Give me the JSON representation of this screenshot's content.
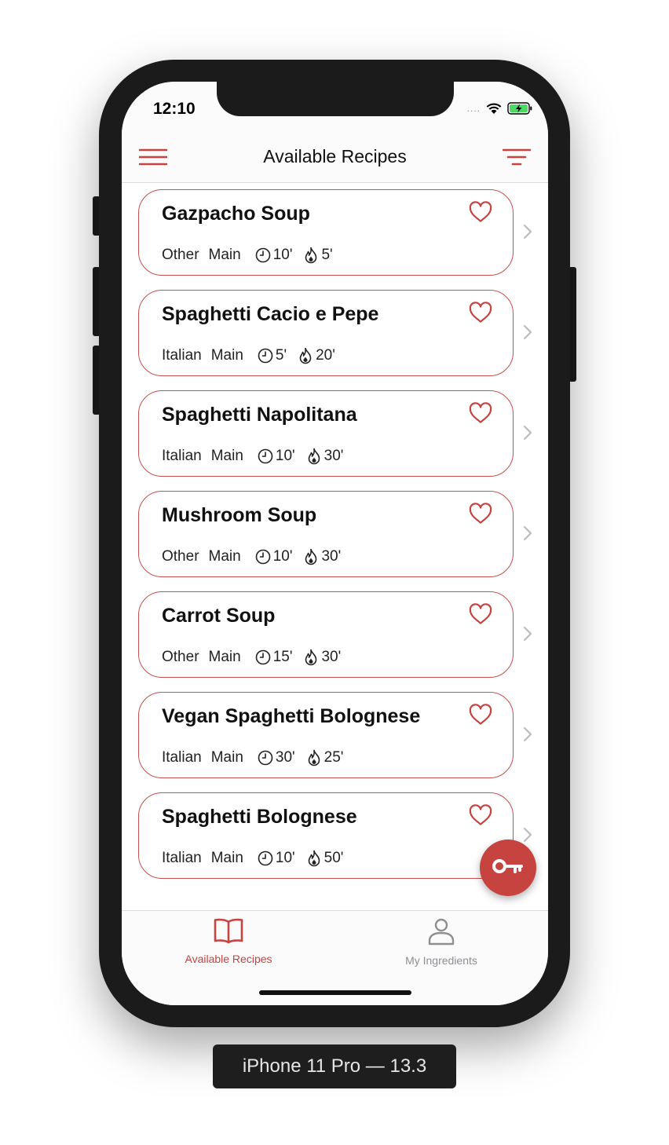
{
  "status_bar": {
    "time": "12:10",
    "signal": "....",
    "wifi_icon": "wifi-icon",
    "battery_icon": "battery-charging-icon"
  },
  "nav": {
    "title": "Available Recipes",
    "left_icon": "menu-icon",
    "right_icon": "sort-filter-icon"
  },
  "colors": {
    "accent": "#c64340",
    "card_border": "#c9504c",
    "inactive": "#8e8e93"
  },
  "recipes": [
    {
      "name": "Gazpacho Soup",
      "cuisine": "Other",
      "course": "Main",
      "prep": "10'",
      "cook": "5'"
    },
    {
      "name": "Spaghetti Cacio e Pepe",
      "cuisine": "Italian",
      "course": "Main",
      "prep": "5'",
      "cook": "20'"
    },
    {
      "name": "Spaghetti Napolitana",
      "cuisine": "Italian",
      "course": "Main",
      "prep": "10'",
      "cook": "30'"
    },
    {
      "name": "Mushroom Soup",
      "cuisine": "Other",
      "course": "Main",
      "prep": "10'",
      "cook": "30'"
    },
    {
      "name": "Carrot Soup",
      "cuisine": "Other",
      "course": "Main",
      "prep": "15'",
      "cook": "30'"
    },
    {
      "name": "Vegan Spaghetti Bolognese",
      "cuisine": "Italian",
      "course": "Main",
      "prep": "30'",
      "cook": "25'"
    },
    {
      "name": "Spaghetti Bolognese",
      "cuisine": "Italian",
      "course": "Main",
      "prep": "10'",
      "cook": "50'"
    }
  ],
  "fab": {
    "icon": "key-icon"
  },
  "tabs": [
    {
      "label": "Available Recipes",
      "icon": "book-icon",
      "active": true
    },
    {
      "label": "My Ingredients",
      "icon": "person-icon",
      "active": false
    }
  ],
  "device_label": "iPhone 11 Pro — 13.3"
}
